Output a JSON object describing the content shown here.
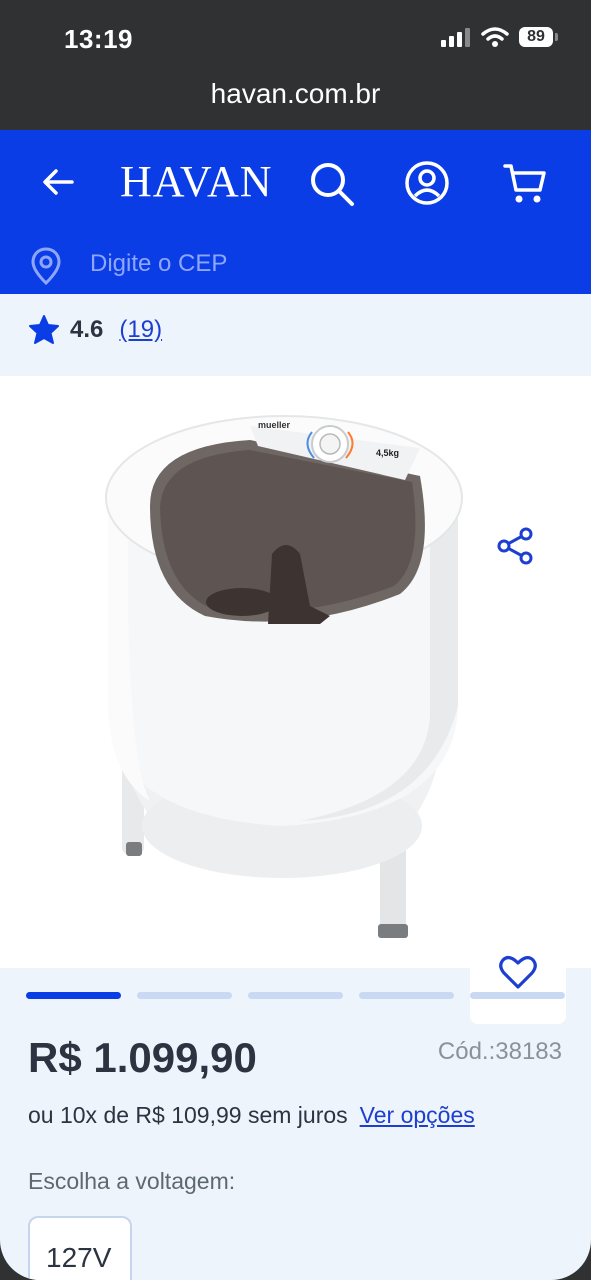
{
  "status_bar": {
    "time": "13:19",
    "battery": "89"
  },
  "browser": {
    "url": "havan.com.br"
  },
  "header": {
    "logo": "HAVAN"
  },
  "cep": {
    "placeholder": "Digite o CEP"
  },
  "product": {
    "rating": "4.6",
    "review_count": "(19)",
    "brand_on_image": "mueller",
    "capacity_on_image": "4,5kg",
    "price": "R$ 1.099,90",
    "code": "Cód.:38183",
    "installments": "ou 10x de R$ 109,99 sem juros",
    "installments_link": "Ver opções",
    "voltage_label": "Escolha a voltagem:",
    "voltage_options": [
      "127V"
    ],
    "gallery_total": 5,
    "gallery_active": 1
  },
  "colors": {
    "brand_blue": "#0a3de6",
    "link_blue": "#1d3fd1",
    "text_dark": "#2b3440"
  }
}
